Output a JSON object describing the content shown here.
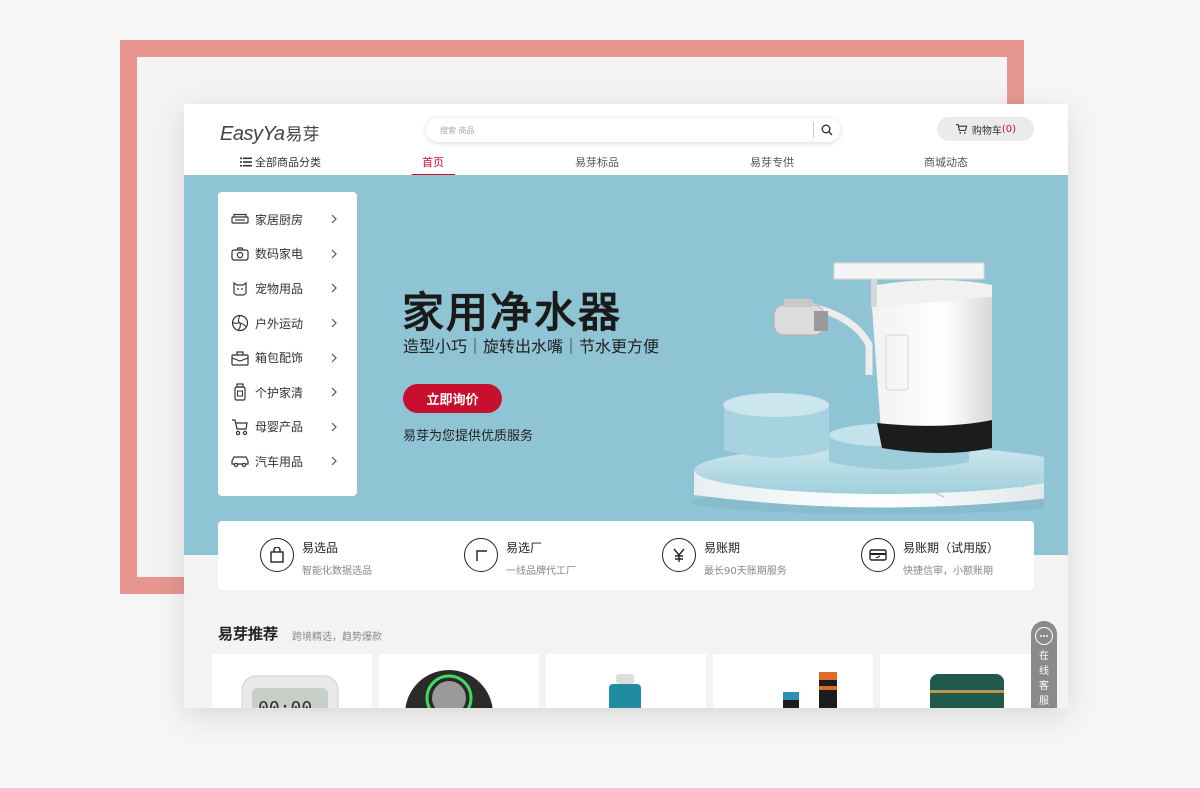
{
  "brand": {
    "logo_en": "EasyYa",
    "logo_cn": "易芽"
  },
  "search": {
    "placeholder": "搜索 商品"
  },
  "cart": {
    "label": "购物车",
    "count": "(0)"
  },
  "nav": {
    "all_categories": "全部商品分类",
    "items": [
      {
        "label": "首页",
        "active": true
      },
      {
        "label": "易芽标品"
      },
      {
        "label": "易芽专供"
      },
      {
        "label": "商城动态"
      }
    ]
  },
  "categories": [
    {
      "label": "家居厨房",
      "icon": "sofa-icon"
    },
    {
      "label": "数码家电",
      "icon": "camera-icon"
    },
    {
      "label": "宠物用品",
      "icon": "pet-icon"
    },
    {
      "label": "户外运动",
      "icon": "volleyball-icon"
    },
    {
      "label": "箱包配饰",
      "icon": "bag-icon"
    },
    {
      "label": "个护家清",
      "icon": "bottle-icon"
    },
    {
      "label": "母婴产品",
      "icon": "stroller-icon"
    },
    {
      "label": "汽车用品",
      "icon": "car-icon"
    }
  ],
  "hero": {
    "title": "家用净水器",
    "subtitle": "造型小巧｜旋转出水嘴｜节水更方便",
    "cta": "立即询价",
    "note": "易芽为您提供优质服务"
  },
  "features": [
    {
      "title": "易选品",
      "subtitle": "智能化数据选品",
      "icon": "shopping-bag-icon"
    },
    {
      "title": "易选厂",
      "subtitle": "一线品牌代工厂",
      "icon": "factory-icon"
    },
    {
      "title": "易账期",
      "subtitle": "最长90天账期服务",
      "icon": "yen-icon"
    },
    {
      "title": "易账期（试用版）",
      "subtitle": "快捷信审，小额账期",
      "icon": "card-icon"
    }
  ],
  "recommend": {
    "title": "易芽推荐",
    "subtitle": "跨境精选，趋势爆款"
  },
  "service": {
    "label": "在线客服"
  },
  "colors": {
    "accent": "#c8102e",
    "banner": "#8fc4d4",
    "frame": "#e89690"
  }
}
